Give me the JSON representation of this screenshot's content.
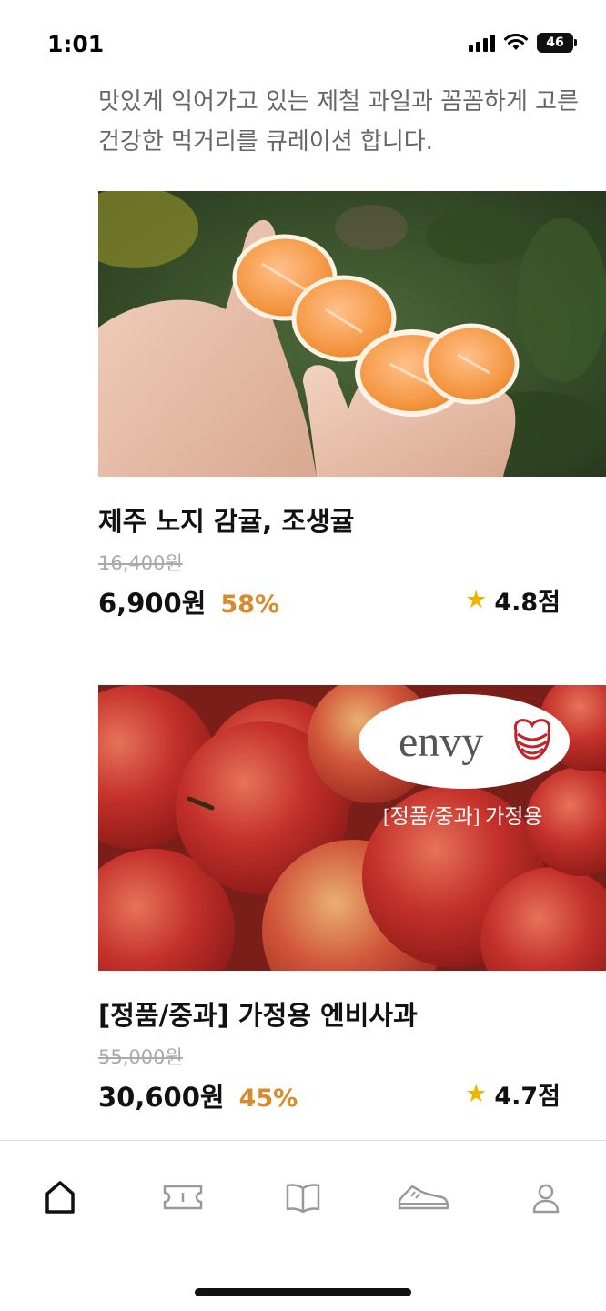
{
  "status_bar": {
    "time": "1:01",
    "battery": "46"
  },
  "intro_text": "맛있게 익어가고 있는 제철 과일과 꼼꼼하게 고른 건강한 먹거리를 큐레이션 합니다.",
  "products": [
    {
      "name": "제주 노지 감귤, 조생귤",
      "original_price": "16,400원",
      "price": "6,900원",
      "discount": "58%",
      "rating": "4.8점"
    },
    {
      "name": "[정품/중과] 가정용 엔비사과",
      "original_price": "55,000원",
      "price": "30,600원",
      "discount": "45%",
      "rating": "4.7점",
      "image_brand": "envy",
      "image_caption": "[정품/중과] 가정용"
    }
  ],
  "tab_bar": {
    "items": [
      "home-icon",
      "ticket-icon",
      "book-icon",
      "shoe-icon",
      "profile-icon"
    ]
  },
  "colors": {
    "discount": "#d98a2b",
    "star": "#f0b400",
    "strike": "#aaaaaa"
  }
}
